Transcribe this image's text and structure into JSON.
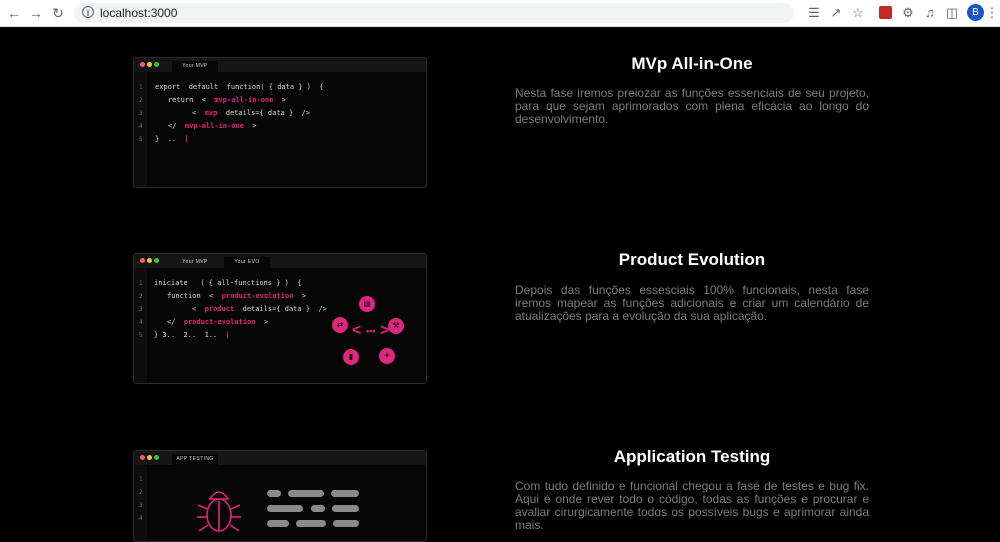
{
  "browser": {
    "url": "localhost:3000",
    "avatar_letter": "B"
  },
  "sections": [
    {
      "title": "MVp All-in-One",
      "description": "Nesta fase iremos preiozar as funções essenciais de seu projeto, para que sejam aprimorados com plena eficácia ao longo do desenvolvimento.",
      "tabs": [
        "Your MVP"
      ],
      "line_numbers": [
        "1",
        "2",
        "3",
        "4",
        "5"
      ]
    },
    {
      "title": "Product Evolution",
      "description": "Depois das funções essesciais 100% funcionais, nesta fase iremos mapear as funções adicionais e criar um calendário de atualizações para a evolução da sua aplicação.",
      "tabs": [
        "Your MVP",
        "Your EVO"
      ],
      "line_numbers": [
        "1",
        "2",
        "3",
        "4",
        "5"
      ]
    },
    {
      "title": "Application Testing",
      "description": "Com tudo definido e funcional chegou a fase de testes e bug fix. Aqui é onde rever todo o código, todas as funções e procurar e avaliar cirurgicamente todos os possíveis bugs e aprimorar ainda mais.",
      "tabs": [
        "APP TESTING"
      ],
      "line_numbers": [
        "1",
        "2",
        "3",
        "4"
      ]
    }
  ],
  "code1": {
    "l1": "export  default  function( { data } )  {",
    "l2a": "return  <  ",
    "l2b": "mvp-all-in-one",
    "l2c": "  >",
    "l3a": "<  ",
    "l3b": "mvp",
    "l3c": "  details={ data }  />",
    "l4a": "</  ",
    "l4b": "mvp-all-in-one",
    "l4c": "  >",
    "l5a": "}  ..  ",
    "l5b": "|"
  },
  "code2": {
    "l1": "iniciate   ( { all-functions } )  {",
    "l2a": "function  <  ",
    "l2b": "product-evolution",
    "l2c": "  >",
    "l3a": "<  ",
    "l3b": "product",
    "l3c": "  details={ data }  />",
    "l4a": "</  ",
    "l4b": "product-evolution",
    "l4c": "  >",
    "l5a": "} 3..  2..  1..  ",
    "l5b": "|"
  },
  "colors": {
    "accent": "#e0267e",
    "dot_red": "#ff5f57",
    "dot_yellow": "#febc2e",
    "dot_green": "#28c840"
  }
}
